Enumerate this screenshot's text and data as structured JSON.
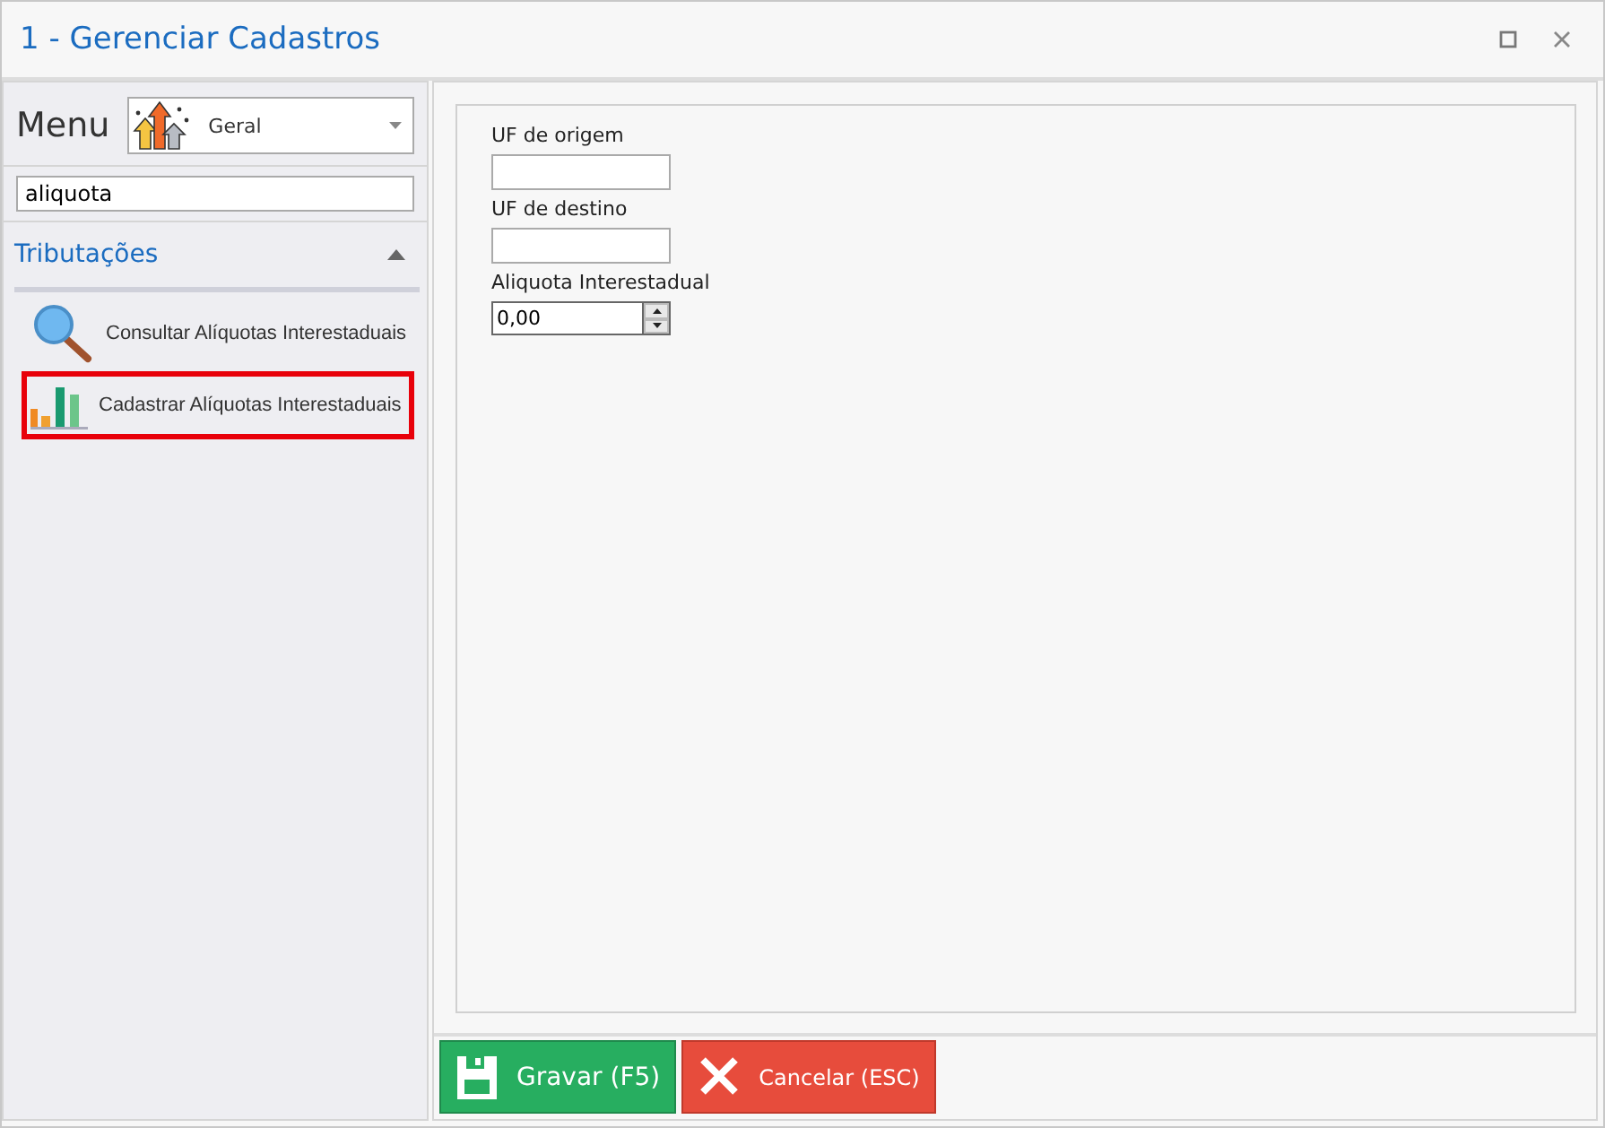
{
  "window": {
    "title": "1 - Gerenciar Cadastros"
  },
  "sidebar": {
    "menu_label": "Menu",
    "module": "Geral",
    "search": {
      "value": "aliquota"
    },
    "groups": [
      {
        "label": "Tributações",
        "expanded": true,
        "items": [
          {
            "label": "Consultar Alíquotas Interestaduais",
            "kind": "search",
            "selected": false
          },
          {
            "label": "Cadastrar Alíquotas Interestaduais",
            "kind": "chart",
            "selected": true
          }
        ]
      }
    ]
  },
  "form": {
    "fields": [
      {
        "label": "UF de origem",
        "kind": "text"
      },
      {
        "label": "UF de destino",
        "kind": "text"
      },
      {
        "label": "Aliquota Interestadual",
        "kind": "spin",
        "value": "0,00"
      }
    ]
  },
  "buttons": [
    {
      "label": "Gravar (F5)",
      "kind": "save"
    },
    {
      "label": "Cancelar (ESC)",
      "kind": "cancel"
    }
  ]
}
